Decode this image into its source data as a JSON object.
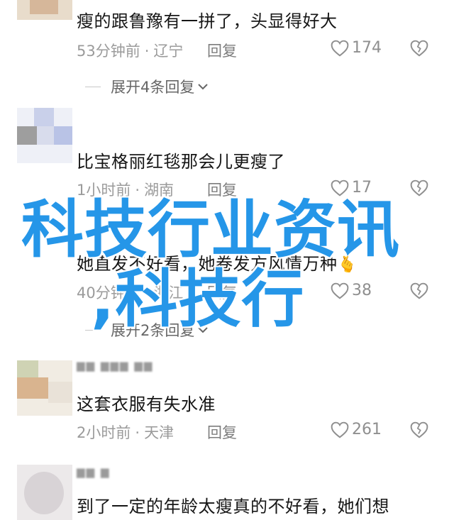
{
  "comments": [
    {
      "text": "瘦的跟鲁豫有一拼了，头显得好大",
      "time": "53分钟前",
      "location": "辽宁",
      "reply": "回复",
      "likes": "174",
      "expand": "展开4条回复"
    },
    {
      "text": "比宝格丽红毯那会儿更瘦了",
      "time": "1小时前",
      "location": "湖南",
      "reply": "回复",
      "likes": "17"
    },
    {
      "text": "她直发不好看，她卷发方风情万种",
      "emoji": "🫰",
      "time": "40分钟前",
      "location": "浙江",
      "reply": "回复",
      "likes": "38",
      "expand": "展开2条回复"
    },
    {
      "text": "这套衣服有失水准",
      "time": "2小时前",
      "location": "天津",
      "reply": "回复",
      "likes": "261"
    },
    {
      "text": "到了一定的年龄太瘦真的不好看，她们想"
    }
  ],
  "watermark": {
    "line1": "科技行业资讯",
    "line2": ",科技行"
  },
  "colors": {
    "watermark": "#2596e8",
    "meta": "#9b9b9b",
    "text": "#161616"
  }
}
